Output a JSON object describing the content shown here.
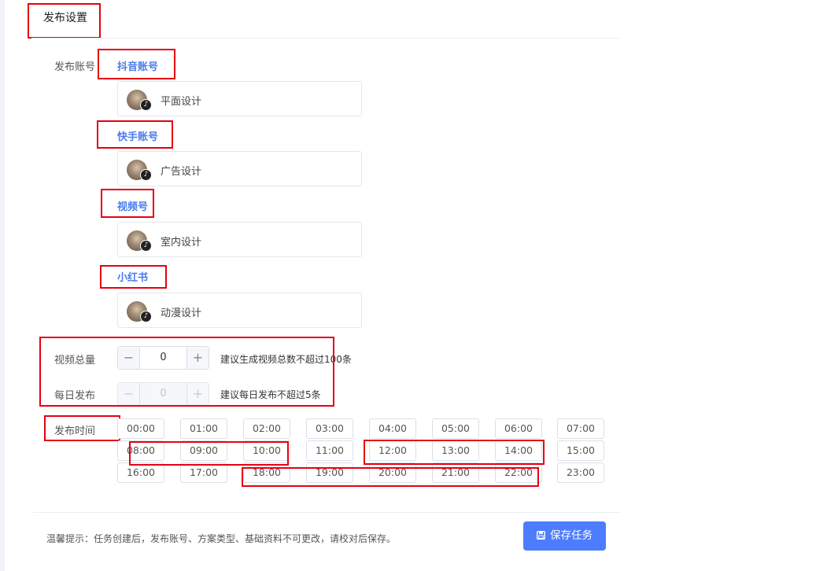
{
  "header": {
    "title": "发布设置"
  },
  "form": {
    "accounts_label": "发布账号",
    "platforms": [
      {
        "name": "抖音账号",
        "account": "平面设计",
        "icon": "tiktok-icon"
      },
      {
        "name": "快手账号",
        "account": "广告设计",
        "icon": "tiktok-icon"
      },
      {
        "name": "视频号",
        "account": "室内设计",
        "icon": "tiktok-icon"
      },
      {
        "name": "小红书",
        "account": "动漫设计",
        "icon": "tiktok-icon"
      }
    ],
    "total_label": "视频总量",
    "total_value": "0",
    "total_hint": "建议生成视频总数不超过100条",
    "daily_label": "每日发布",
    "daily_value": "0",
    "daily_hint": "建议每日发布不超过5条",
    "time_label": "发布时间",
    "stepper_minus": "−",
    "stepper_plus": "+",
    "times": [
      "00:00",
      "01:00",
      "02:00",
      "03:00",
      "04:00",
      "05:00",
      "06:00",
      "07:00",
      "08:00",
      "09:00",
      "10:00",
      "11:00",
      "12:00",
      "13:00",
      "14:00",
      "15:00",
      "16:00",
      "17:00",
      "18:00",
      "19:00",
      "20:00",
      "21:00",
      "22:00",
      "23:00"
    ]
  },
  "footer": {
    "tip": "温馨提示：任务创建后，发布账号、方案类型、基础资料不可更改，请校对后保存。",
    "save_label": "保存任务",
    "save_icon": "save-icon"
  },
  "colors": {
    "accent": "#4d7cfe",
    "platform_text": "#4a7bf0",
    "highlight": "#e60012"
  }
}
